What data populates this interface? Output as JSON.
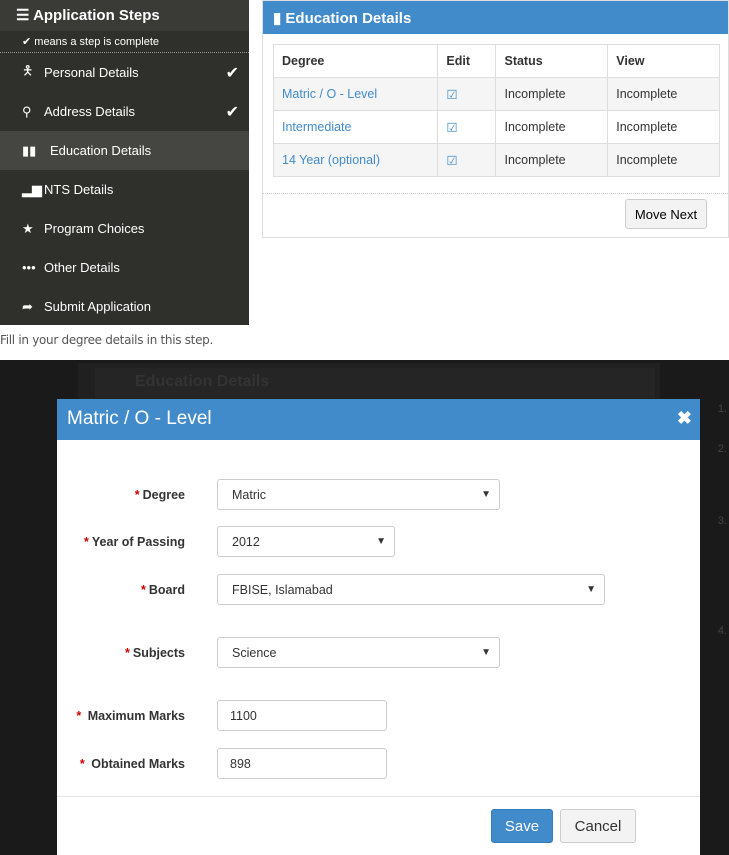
{
  "sidebar": {
    "title": "Application Steps",
    "legend": "means a step is complete",
    "items": [
      {
        "label": "Personal Details",
        "icon": "person-icon",
        "complete": true
      },
      {
        "label": "Address Details",
        "icon": "map-marker-icon",
        "complete": true
      },
      {
        "label": "Education Details",
        "icon": "book-icon",
        "active": true
      },
      {
        "label": "NTS Details",
        "icon": "bar-chart-icon"
      },
      {
        "label": "Program Choices",
        "icon": "star-icon"
      },
      {
        "label": "Other Details",
        "icon": "ellipsis-icon"
      },
      {
        "label": "Submit Application",
        "icon": "share-arrow-icon"
      }
    ]
  },
  "panel": {
    "title": "Education Details",
    "columns": [
      "Degree",
      "Edit",
      "Status",
      "View"
    ],
    "rows": [
      {
        "degree": "Matric / O - Level",
        "status": "Incomplete",
        "view": "Incomplete"
      },
      {
        "degree": "Intermediate",
        "status": "Incomplete",
        "view": "Incomplete"
      },
      {
        "degree": "14 Year (optional)",
        "status": "Incomplete",
        "view": "Incomplete"
      }
    ],
    "move_next": "Move Next"
  },
  "hint": "Fill in your degree details in this step.",
  "modal": {
    "title": "Matric / O - Level",
    "close": "✖",
    "fields": {
      "degree": {
        "label": "Degree",
        "value": "Matric"
      },
      "year": {
        "label": "Year of Passing",
        "value": "2012"
      },
      "board": {
        "label": "Board",
        "value": "FBISE, Islamabad"
      },
      "subjects": {
        "label": "Subjects",
        "value": "Science"
      },
      "max_marks": {
        "label": "Maximum Marks",
        "value": "1100"
      },
      "obtained_marks": {
        "label": "Obtained Marks",
        "value": "898"
      }
    },
    "save": "Save",
    "cancel": "Cancel"
  },
  "colors": {
    "primary": "#428bca",
    "sidebar": "#2f2f2b",
    "required": "#cc0000"
  }
}
